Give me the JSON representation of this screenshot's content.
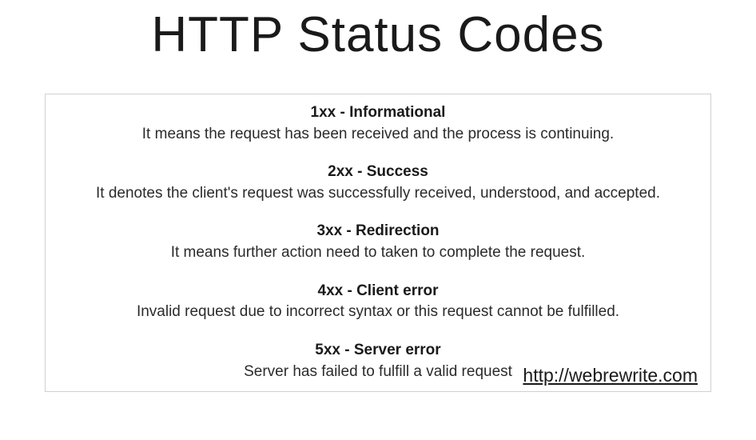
{
  "title": "HTTP Status Codes",
  "sections": [
    {
      "heading": "1xx - Informational",
      "desc": "It means the request has been received and the process is continuing."
    },
    {
      "heading": "2xx - Success",
      "desc": "It denotes the client's request was successfully received, understood, and accepted."
    },
    {
      "heading": "3xx - Redirection",
      "desc": "It means further action need to taken to complete the request."
    },
    {
      "heading": "4xx - Client error",
      "desc": "Invalid request due to incorrect syntax or this request cannot be fulfilled."
    },
    {
      "heading": "5xx - Server error",
      "desc": "Server has failed to fulfill a valid request"
    }
  ],
  "link": "http://webrewrite.com"
}
